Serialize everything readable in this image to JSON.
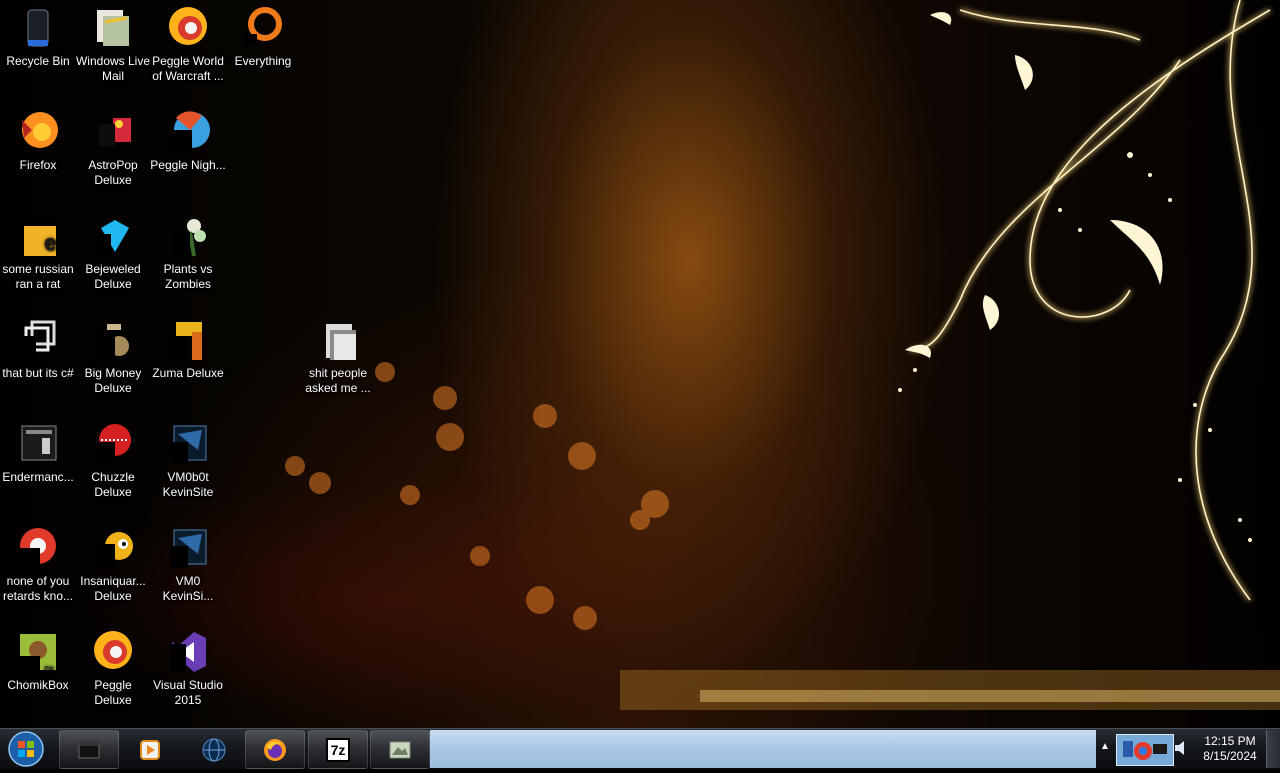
{
  "desktop": {
    "icons": [
      {
        "label": "Recycle Bin",
        "icon": "recycle-bin-icon"
      },
      {
        "label": "Windows Live Mail",
        "icon": "mail-icon"
      },
      {
        "label": "Peggle World of Warcraft ...",
        "icon": "peggle-icon"
      },
      {
        "label": "Everything",
        "icon": "everything-search-icon"
      },
      {
        "label": "Firefox",
        "icon": "firefox-icon"
      },
      {
        "label": "AstroPop Deluxe",
        "icon": "astropop-icon"
      },
      {
        "label": "Peggle Nigh...",
        "icon": "peggle-nights-icon"
      },
      {
        "label": "some russian ran a rat",
        "icon": "document-icon"
      },
      {
        "label": "Bejeweled Deluxe",
        "icon": "bejeweled-icon"
      },
      {
        "label": "Plants vs Zombies",
        "icon": "plants-vs-zombies-icon"
      },
      {
        "label": "that but its c#",
        "icon": "folder-stack-icon"
      },
      {
        "label": "Big Money Deluxe",
        "icon": "big-money-icon"
      },
      {
        "label": "Zuma Deluxe",
        "icon": "zuma-icon"
      },
      {
        "label": "shit people asked me ...",
        "icon": "folder-icon"
      },
      {
        "label": "Endermanc...",
        "icon": "endermanch-icon"
      },
      {
        "label": "Chuzzle Deluxe",
        "icon": "chuzzle-icon"
      },
      {
        "label": "VM0b0t KevinSite",
        "icon": "vm-site-icon"
      },
      {
        "label": "none of you retards kno...",
        "icon": "chrome-icon"
      },
      {
        "label": "Insaniquar... Deluxe",
        "icon": "insaniquarium-icon"
      },
      {
        "label": "VM0 KevinSi...",
        "icon": "vm-site-icon"
      },
      {
        "label": "ChomikBox",
        "icon": "chomikbox-icon"
      },
      {
        "label": "Peggle Deluxe",
        "icon": "peggle-icon"
      },
      {
        "label": "Visual Studio 2015",
        "icon": "visual-studio-icon"
      }
    ]
  },
  "taskbar": {
    "start_icon": "windows-start-orb-icon",
    "pinned": [
      {
        "icon": "command-prompt-icon"
      },
      {
        "icon": "media-player-icon"
      },
      {
        "icon": "globe-icon"
      },
      {
        "icon": "firefox-icon"
      },
      {
        "icon": "7zip-icon",
        "text": "7z"
      },
      {
        "icon": "image-app-icon"
      }
    ],
    "tray_arrow": "▲",
    "clock": {
      "time": "12:15 PM",
      "date": "8/15/2024"
    }
  },
  "colors": {
    "accent_gold": "#f5c24a",
    "taskbar_blue": "#a9c7e4"
  }
}
